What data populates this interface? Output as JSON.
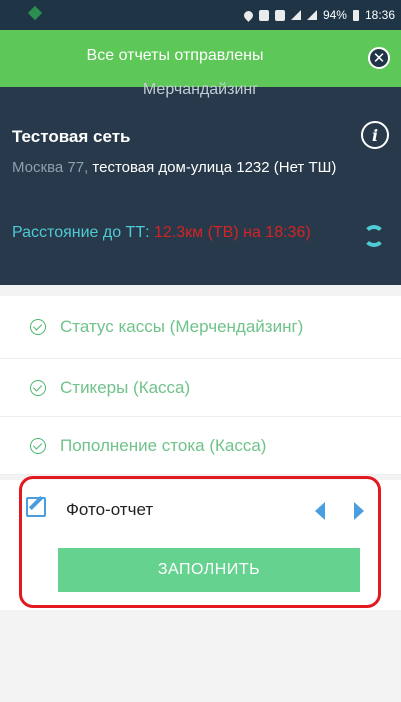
{
  "status_bar": {
    "battery": "94%",
    "time": "18:36"
  },
  "toast": {
    "message": "Все отчеты отправлены",
    "close_icon": "close-circle-icon"
  },
  "header": {
    "cut_title": "Мерчандайзинг",
    "shop_name": "Тестовая сеть",
    "address_city": "Москва 77,",
    "address_rest": " тестовая дом-улица 1232 (Нет ТШ)",
    "distance_label": "Расстояние до ТТ: ",
    "distance_value": "12.3км (ТВ) на 18:36)",
    "info_icon": "info-icon",
    "refresh_icon": "refresh-icon"
  },
  "list": {
    "items": [
      {
        "label": "Статус кассы (Мерчендайзинг)"
      },
      {
        "label": "Стикеры (Касса)"
      },
      {
        "label": "Пополнение стока (Касса)"
      }
    ]
  },
  "photo_report": {
    "title": "Фото-отчет",
    "button_label": "ЗАПОЛНИТЬ"
  },
  "colors": {
    "toast_bg": "#5dc757",
    "header_bg": "#27394a",
    "accent_green": "#66d28f",
    "accent_blue": "#4a9ee0",
    "highlight_red": "#e2191e"
  }
}
